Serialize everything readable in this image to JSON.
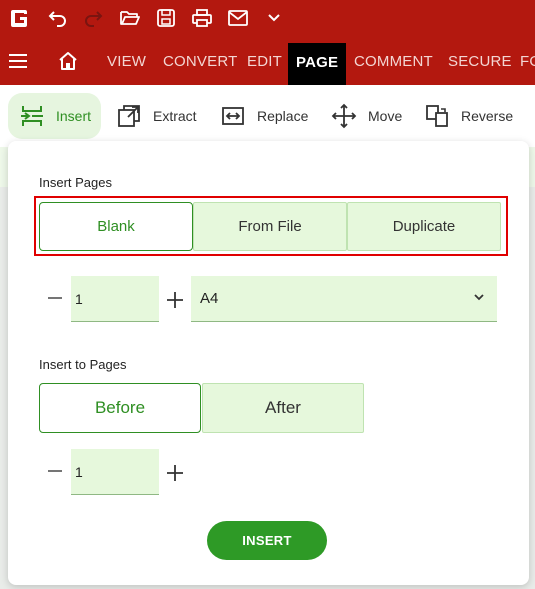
{
  "titlebar": {
    "icons": [
      "app-logo-icon",
      "undo-icon",
      "redo-icon",
      "open-folder-icon",
      "save-icon",
      "print-icon",
      "mail-icon",
      "chevron-down-icon"
    ]
  },
  "tabs": [
    "VIEW",
    "CONVERT",
    "EDIT",
    "PAGE",
    "COMMENT",
    "SECURE",
    "FO"
  ],
  "active_tab": "PAGE",
  "toolbar": {
    "items": [
      {
        "label": "Insert",
        "icon": "insert-pages-icon"
      },
      {
        "label": "Extract",
        "icon": "extract-icon"
      },
      {
        "label": "Replace",
        "icon": "replace-icon"
      },
      {
        "label": "Move",
        "icon": "move-icon"
      },
      {
        "label": "Reverse",
        "icon": "reverse-icon"
      }
    ]
  },
  "panel": {
    "insert_pages_label": "Insert Pages",
    "source_options": [
      "Blank",
      "From File",
      "Duplicate"
    ],
    "source_selected": "Blank",
    "count_value": "1",
    "page_size_value": "A4",
    "insert_to_label": "Insert to Pages",
    "position_options": [
      "Before",
      "After"
    ],
    "position_selected": "Before",
    "page_number_value": "1",
    "insert_button": "INSERT"
  },
  "colors": {
    "brand_red": "#b3180f",
    "accent_green": "#2f8f23",
    "light_green": "#e6f8dc",
    "highlight_red": "#e00000"
  }
}
